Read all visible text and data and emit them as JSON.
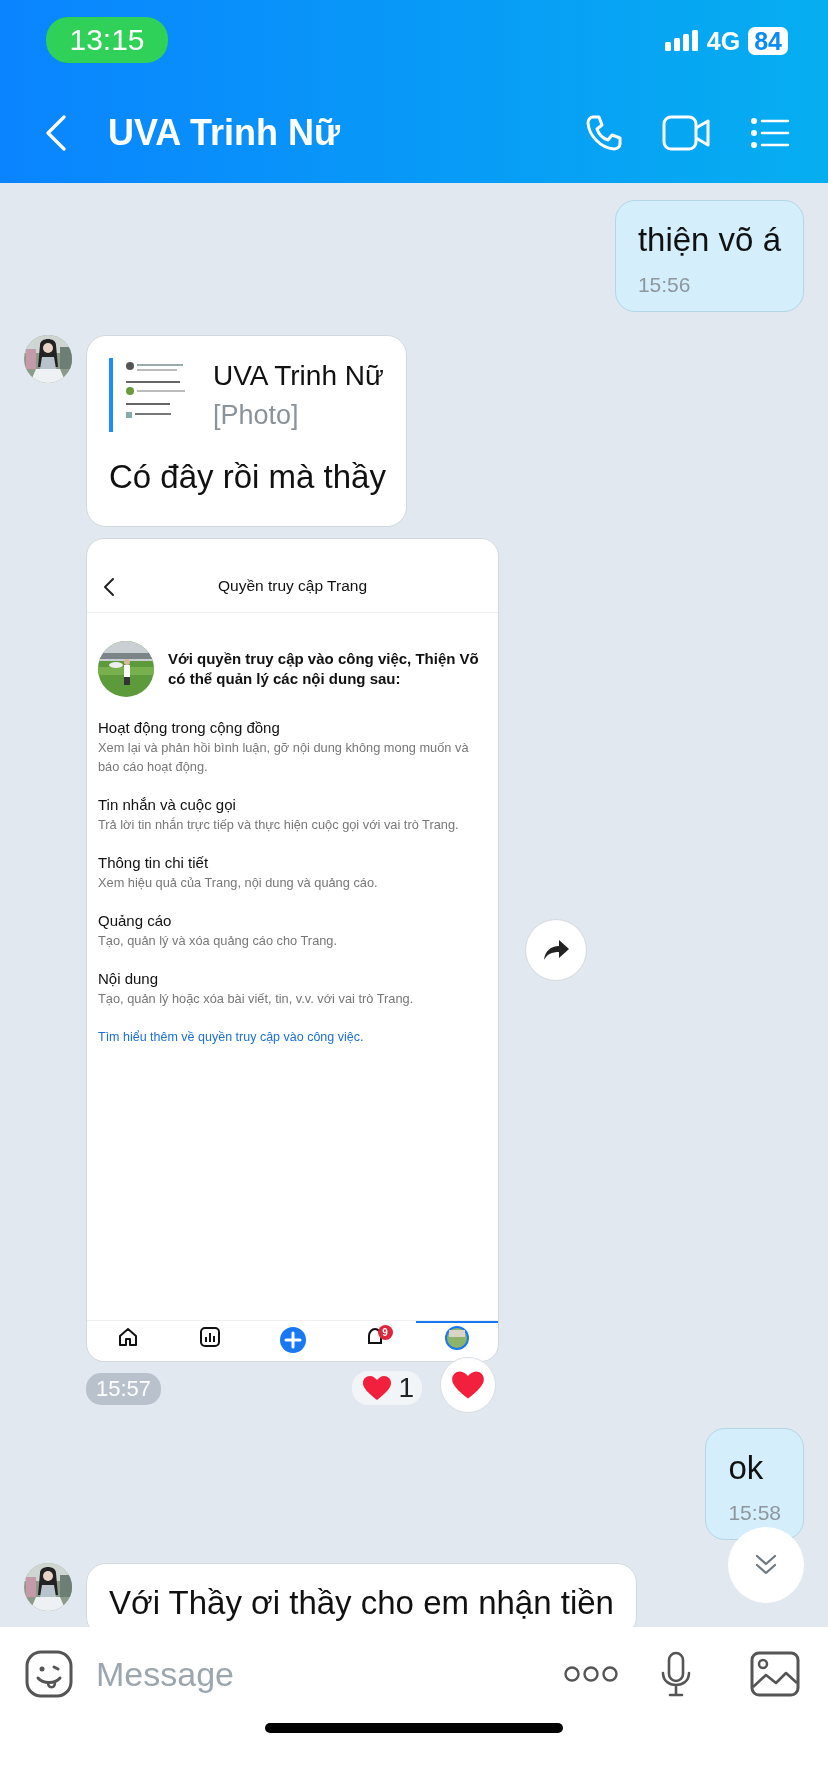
{
  "status_bar": {
    "time": "13:15",
    "network": "4G",
    "battery": "84"
  },
  "header": {
    "title": "UVA Trinh Nữ"
  },
  "messages": [
    {
      "kind": "text",
      "outgoing": true,
      "text": "thiện võ á",
      "time": "15:56"
    },
    {
      "kind": "reply",
      "outgoing": false,
      "avatar": true,
      "quote": {
        "sender": "UVA Trinh Nữ",
        "preview": "[Photo]"
      },
      "text": "Có đây rồi mà thầy"
    },
    {
      "kind": "screenshot",
      "outgoing": false,
      "avatar": false,
      "time": "15:57",
      "reaction_count": "1",
      "screenshot": {
        "title": "Quyền truy cập Trang",
        "intro": "Với quyền truy cập vào công việc, Thiện Võ có thể quản lý các nội dung sau:",
        "sections": [
          {
            "title": "Hoạt động trong cộng đồng",
            "description": "Xem lại và phản hồi bình luận, gỡ nội dung không mong muốn và báo cáo hoạt động."
          },
          {
            "title": "Tin nhắn và cuộc gọi",
            "description": "Trả lời tin nhắn trực tiếp và thực hiện cuộc gọi với vai trò Trang."
          },
          {
            "title": "Thông tin chi tiết",
            "description": "Xem hiệu quả của Trang, nội dung và quảng cáo."
          },
          {
            "title": "Quảng cáo",
            "description": "Tạo, quản lý và xóa quảng cáo cho Trang."
          },
          {
            "title": "Nội dung",
            "description": "Tạo, quản lý hoặc xóa bài viết, tin, v.v. với vai trò Trang."
          }
        ],
        "link": "Tìm hiểu thêm về quyền truy cập vào công việc.",
        "tabs": [
          {
            "kind": "home",
            "selected": false
          },
          {
            "kind": "insights",
            "selected": false
          },
          {
            "kind": "create",
            "selected": false
          },
          {
            "kind": "notifications",
            "selected": false,
            "badge": "9"
          },
          {
            "kind": "profile",
            "selected": true
          }
        ]
      }
    },
    {
      "kind": "text",
      "outgoing": true,
      "text": "ok",
      "time": "15:58"
    },
    {
      "kind": "text",
      "outgoing": false,
      "avatar": true,
      "text": "Với Thầy ơi thầy cho em nhận tiền"
    }
  ],
  "composer": {
    "placeholder": "Message"
  }
}
